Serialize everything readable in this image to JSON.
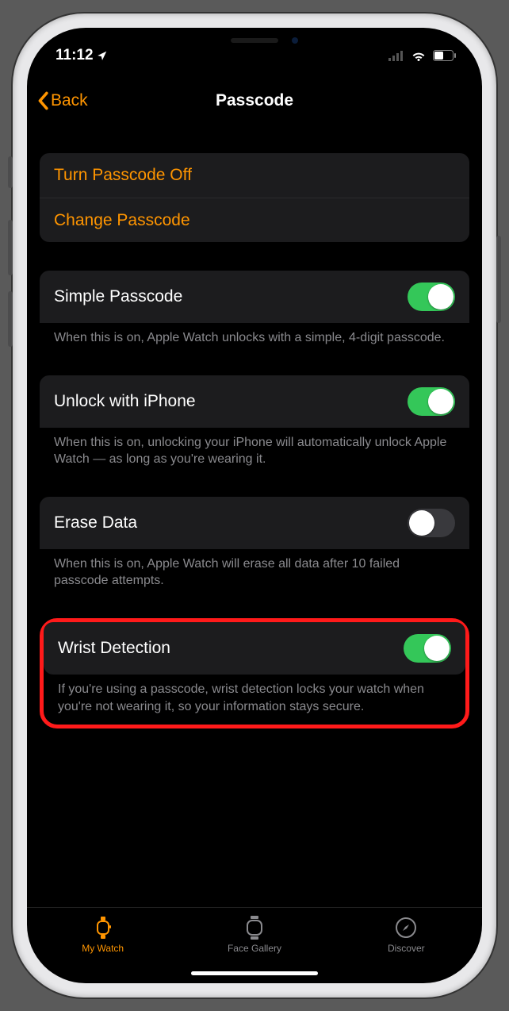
{
  "status": {
    "time": "11:12",
    "location_arrow": true
  },
  "nav": {
    "back_label": "Back",
    "title": "Passcode"
  },
  "group_actions": {
    "turn_off": "Turn Passcode Off",
    "change": "Change Passcode"
  },
  "simple_passcode": {
    "label": "Simple Passcode",
    "on": true,
    "note": "When this is on, Apple Watch unlocks with a simple, 4-digit passcode."
  },
  "unlock_iphone": {
    "label": "Unlock with iPhone",
    "on": true,
    "note": "When this is on, unlocking your iPhone will automatically unlock Apple Watch — as long as you're wearing it."
  },
  "erase_data": {
    "label": "Erase Data",
    "on": false,
    "note": "When this is on, Apple Watch will erase all data after 10 failed passcode attempts."
  },
  "wrist_detection": {
    "label": "Wrist Detection",
    "on": true,
    "note": "If you're using a passcode, wrist detection locks your watch when you're not wearing it, so your information stays secure."
  },
  "tabs": {
    "my_watch": "My Watch",
    "face_gallery": "Face Gallery",
    "discover": "Discover"
  }
}
